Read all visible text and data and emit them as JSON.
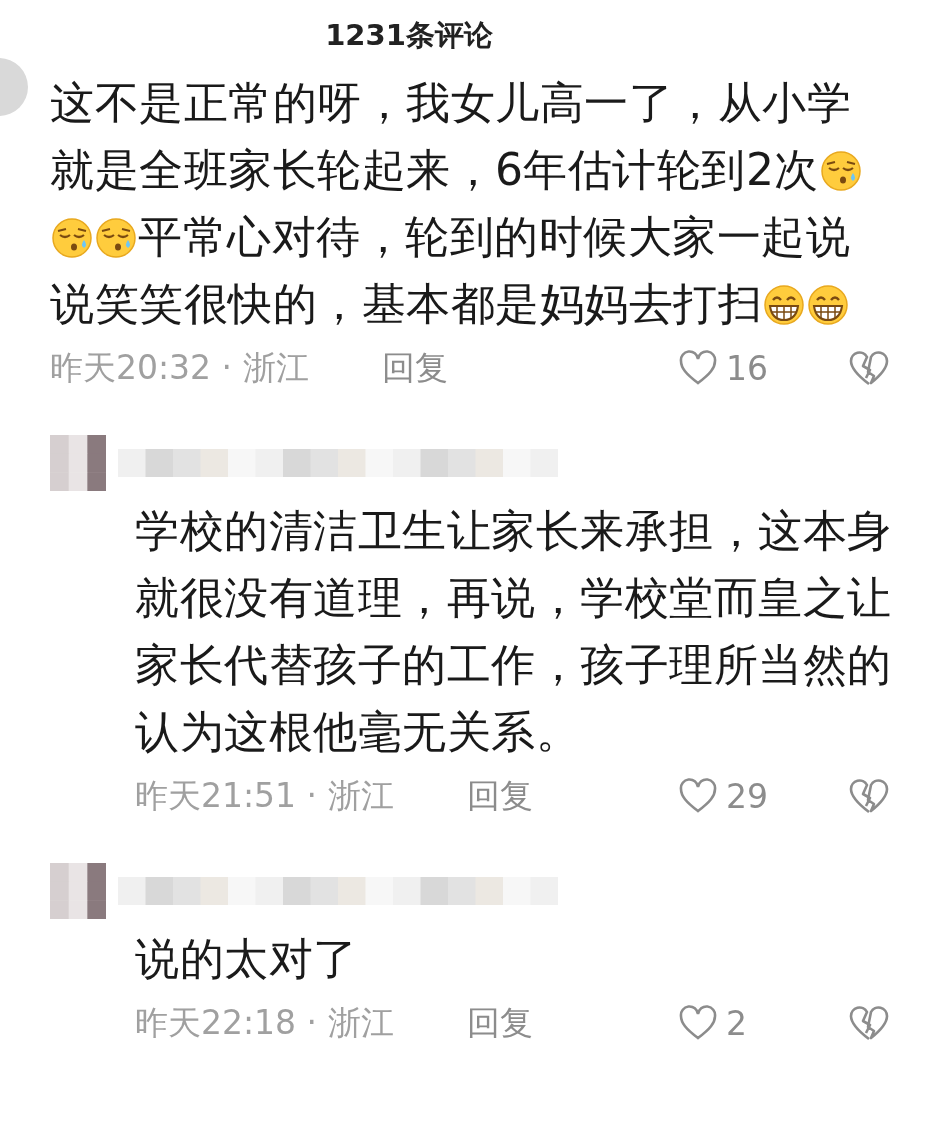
{
  "header": {
    "title": "1231条评论"
  },
  "comments": [
    {
      "kind": "comment",
      "lines": [
        [
          {
            "kind": "text",
            "text": "这不是正常的呀，我女儿高一了，从小学"
          }
        ],
        [
          {
            "kind": "text",
            "text": "就是全班家长轮起来，6年估计轮到2次"
          },
          {
            "kind": "sleepy_emoji"
          }
        ],
        [
          {
            "kind": "sleepy_emoji"
          },
          {
            "kind": "sleepy_emoji"
          },
          {
            "kind": "text",
            "text": "平常心对待，轮到的时候大家一起说"
          }
        ],
        [
          {
            "kind": "text",
            "text": "说笑笑很快的，基本都是妈妈去打扫"
          },
          {
            "kind": "grin_emoji"
          },
          {
            "kind": "grin_emoji"
          }
        ]
      ],
      "time": "昨天20:32 · 浙江",
      "reply": "回复",
      "likes": "16"
    },
    {
      "kind": "reply",
      "lines": [
        [
          {
            "kind": "text",
            "text": "学校的清洁卫生让家长来承担，这本身"
          }
        ],
        [
          {
            "kind": "text",
            "text": "就很没有道理，再说，学校堂而皇之让"
          }
        ],
        [
          {
            "kind": "text",
            "text": "家长代替孩子的工作，孩子理所当然的"
          }
        ],
        [
          {
            "kind": "text",
            "text": "认为这根他毫无关系。"
          }
        ]
      ],
      "time": "昨天21:51 · 浙江",
      "reply": "回复",
      "likes": "29"
    },
    {
      "kind": "reply",
      "lines": [
        [
          {
            "kind": "text",
            "text": "说的太对了"
          }
        ]
      ],
      "time": "昨天22:18 · 浙江",
      "reply": "回复",
      "likes": "2"
    }
  ]
}
